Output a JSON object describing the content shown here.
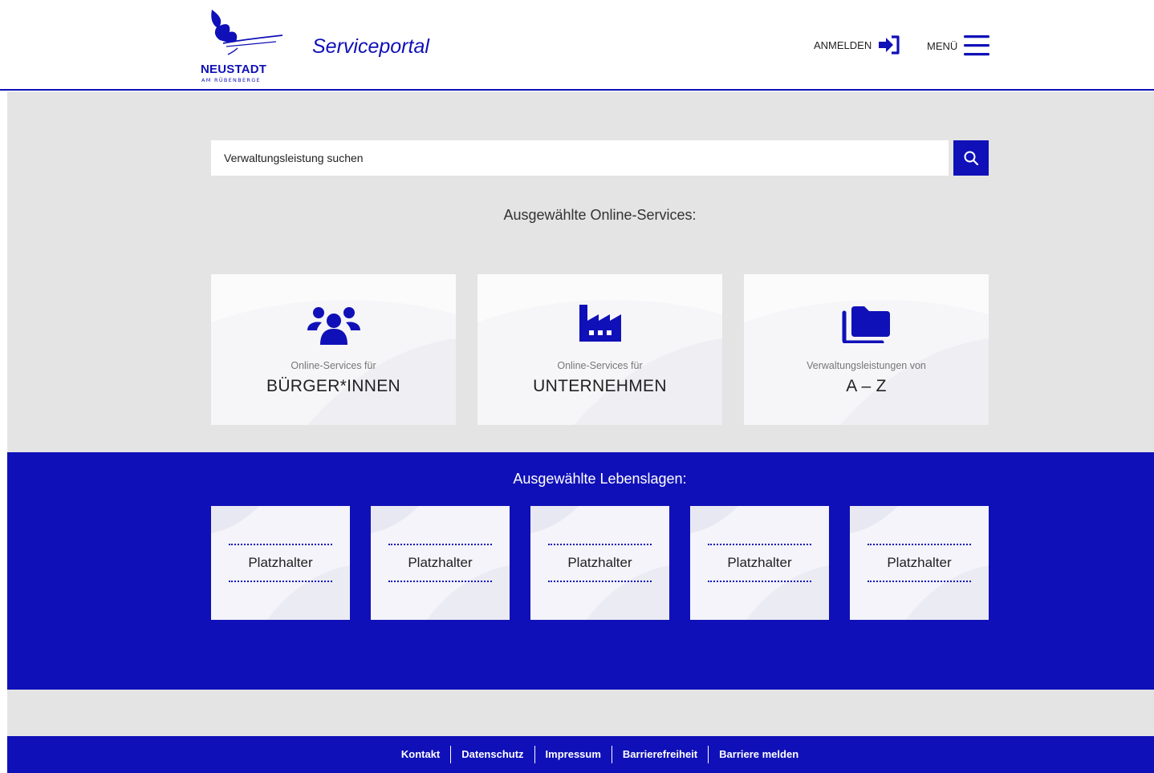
{
  "header": {
    "logo_name": "NEUSTADT",
    "logo_subtitle": "AM RÜBENBERGE",
    "portal_title": "Serviceportal",
    "login_label": "ANMELDEN",
    "menu_label": "MENÜ"
  },
  "search": {
    "placeholder": "Verwaltungsleistung suchen",
    "button_icon": "search-icon"
  },
  "online_services": {
    "heading": "Ausgewählte Online-Services:",
    "cards": [
      {
        "icon": "users-icon",
        "subtitle": "Online-Services für",
        "title": "BÜRGER*INNEN"
      },
      {
        "icon": "industry-icon",
        "subtitle": "Online-Services für",
        "title": "UNTERNEHMEN"
      },
      {
        "icon": "folder-icon",
        "subtitle": "Verwaltungsleistungen von",
        "title": "A – Z"
      }
    ]
  },
  "life_situations": {
    "heading": "Ausgewählte Lebenslagen:",
    "cards": [
      "Platzhalter",
      "Platzhalter",
      "Platzhalter",
      "Platzhalter",
      "Platzhalter"
    ]
  },
  "footer": {
    "links": [
      "Kontakt",
      "Datenschutz",
      "Impressum",
      "Barrierefreiheit",
      "Barriere melden"
    ]
  },
  "colors": {
    "brand_blue": "#1010b8",
    "background_gray": "#e4e4e4",
    "card_background": "#f6f6f8"
  }
}
